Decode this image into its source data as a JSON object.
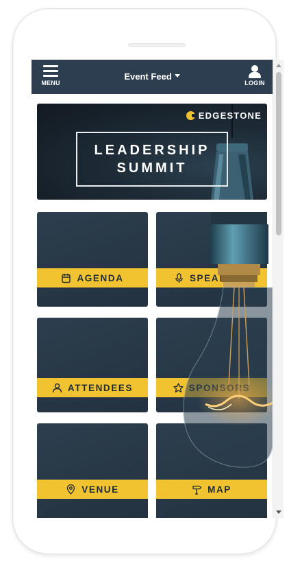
{
  "topbar": {
    "menu_label": "MENU",
    "feed_label": "Event Feed",
    "login_label": "LOGIN"
  },
  "banner": {
    "brand": "EDGESTONE",
    "title_line1": "LEADERSHIP",
    "title_line2": "SUMMIT"
  },
  "tiles": [
    {
      "label": "AGENDA",
      "icon": "calendar-icon"
    },
    {
      "label": "SPEAKERS",
      "icon": "microphone-icon"
    },
    {
      "label": "ATTENDEES",
      "icon": "person-icon"
    },
    {
      "label": "SPONSORS",
      "icon": "star-icon"
    },
    {
      "label": "VENUE",
      "icon": "map-pin-icon"
    },
    {
      "label": "MAP",
      "icon": "signpost-icon"
    }
  ],
  "colors": {
    "header": "#2c3e4f",
    "accent": "#f2c330",
    "tile": "#2a3b4b"
  }
}
